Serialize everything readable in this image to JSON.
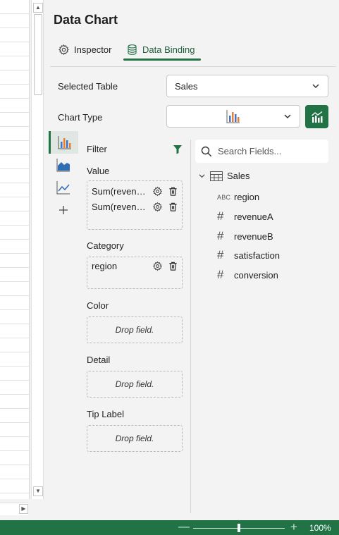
{
  "pane": {
    "title": "Data Chart",
    "tabs": [
      {
        "label": "Inspector",
        "icon": "gear-icon",
        "active": false
      },
      {
        "label": "Data Binding",
        "icon": "database-icon",
        "active": true
      }
    ]
  },
  "selected_table": {
    "label": "Selected Table",
    "value": "Sales"
  },
  "chart_type": {
    "label": "Chart Type",
    "value_icon": "column-chart-icon",
    "button_icon": "chart-settings-icon"
  },
  "chart_rail": [
    {
      "icon": "column-chart-icon",
      "active": true
    },
    {
      "icon": "area-chart-icon",
      "active": false
    },
    {
      "icon": "line-chart-icon",
      "active": false
    },
    {
      "icon": "add-icon",
      "active": false
    }
  ],
  "wells": {
    "filter": {
      "label": "Filter",
      "icon": "filter-icon"
    },
    "value": {
      "label": "Value",
      "fields": [
        "Sum(revenueA)",
        "Sum(revenueB)"
      ]
    },
    "category": {
      "label": "Category",
      "fields": [
        "region"
      ]
    },
    "color": {
      "label": "Color",
      "placeholder": "Drop field."
    },
    "detail": {
      "label": "Detail",
      "placeholder": "Drop field."
    },
    "tip_label": {
      "label": "Tip Label",
      "placeholder": "Drop field."
    }
  },
  "fields_panel": {
    "search_placeholder": "Search Fields...",
    "table": "Sales",
    "fields": [
      {
        "name": "region",
        "type": "ABC"
      },
      {
        "name": "revenueA",
        "type": "#"
      },
      {
        "name": "revenueB",
        "type": "#"
      },
      {
        "name": "satisfaction",
        "type": "#"
      },
      {
        "name": "conversion",
        "type": "#"
      }
    ]
  },
  "status_bar": {
    "zoom": "100%",
    "zoom_level": 0.5
  },
  "colors": {
    "accent": "#217346",
    "chart_blue": "#4472c4",
    "chart_orange": "#ed7d31"
  }
}
